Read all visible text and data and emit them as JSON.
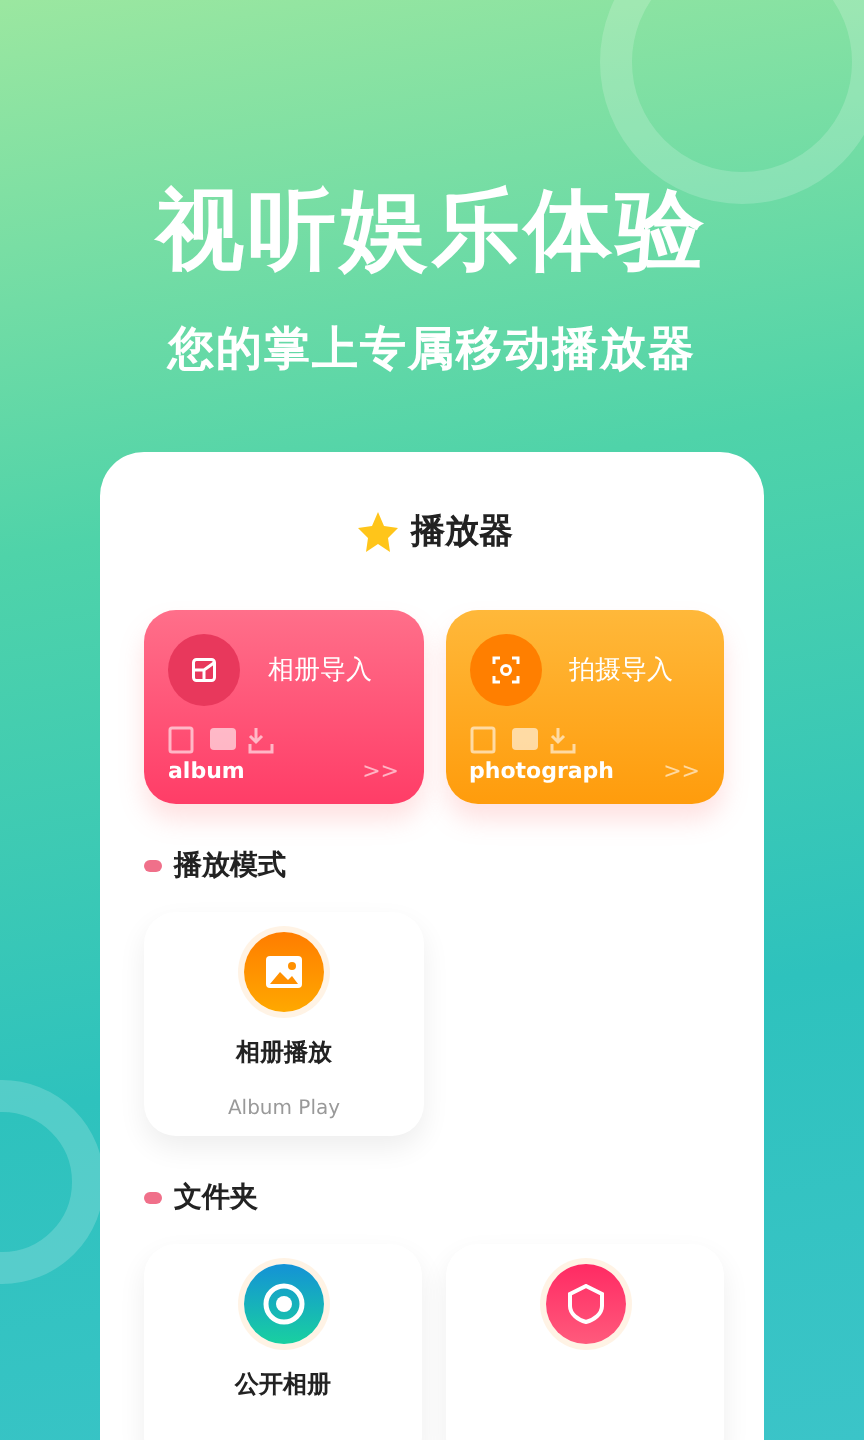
{
  "headline": "视听娱乐体验",
  "subtitle": "您的掌上专属移动播放器",
  "app_title": "播放器",
  "import_cards": [
    {
      "kind": "album",
      "label": "相册导入",
      "caption": "album",
      "arrow": ">>"
    },
    {
      "kind": "photograph",
      "label": "拍摄导入",
      "caption": "photograph",
      "arrow": ">>"
    }
  ],
  "sections": [
    {
      "title": "播放模式",
      "items": [
        {
          "kind": "picture-icon",
          "label": "相册播放",
          "sublabel": "Album Play"
        }
      ]
    },
    {
      "title": "文件夹",
      "items": [
        {
          "kind": "eye-icon",
          "label": "公开相册"
        },
        {
          "kind": "shield-icon"
        }
      ]
    }
  ]
}
